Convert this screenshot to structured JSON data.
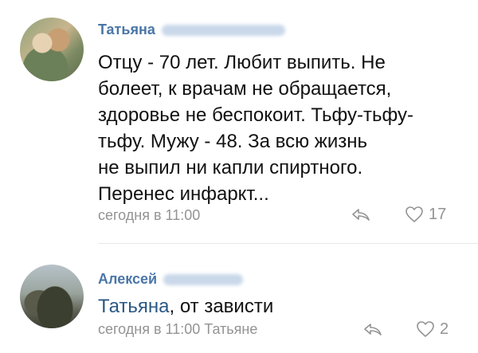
{
  "comments": [
    {
      "author_first": "Татьяна",
      "lines": [
        "Отцу - 70 лет. Любит выпить. Не",
        "болеет, к врачам не обращается,",
        "здоровье не беспокоит. Тьфу-тьфу-",
        "тьфу. Мужу - 48. За всю жизнь",
        "не выпил ни капли спиртного.",
        "Перенес инфаркт..."
      ],
      "time": "сегодня в 11:00",
      "likes": "17",
      "icons": {
        "reply": "reply-icon",
        "like": "heart-icon"
      }
    },
    {
      "author_first": "Алексей",
      "reply_to": "Татьяна",
      "text_rest": ", от зависти",
      "time": "сегодня в 11:00 Татьяне",
      "likes": "2",
      "icons": {
        "reply": "reply-icon",
        "like": "heart-icon"
      }
    }
  ],
  "colors": {
    "link": "#2a5885",
    "meta": "#939393",
    "text": "#111111"
  }
}
